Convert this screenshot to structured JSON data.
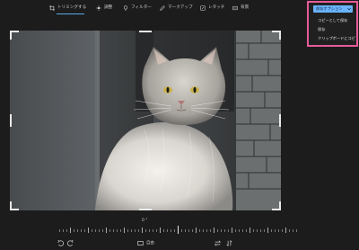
{
  "toolbar": {
    "tabs": [
      {
        "label": "トリミングする",
        "icon": "crop-icon",
        "active": true
      },
      {
        "label": "調整",
        "icon": "brightness-icon",
        "active": false
      },
      {
        "label": "フィルター",
        "icon": "filter-icon",
        "active": false
      },
      {
        "label": "マークアップ",
        "icon": "markup-pen-icon",
        "active": false
      },
      {
        "label": "レタッチ",
        "icon": "retouch-icon",
        "active": false
      },
      {
        "label": "背景",
        "icon": "background-icon",
        "active": false
      }
    ]
  },
  "save_menu": {
    "button_label": "保存オプション",
    "items": [
      "コピーとして保存",
      "保存",
      "クリップボードにコピ"
    ]
  },
  "rotation": {
    "label": "0 °"
  },
  "bottom_bar": {
    "aspect_label": "自由"
  },
  "colors": {
    "accent": "#6ab4ff",
    "highlight_box": "#e85b9a",
    "background": "#1c1c1c"
  }
}
